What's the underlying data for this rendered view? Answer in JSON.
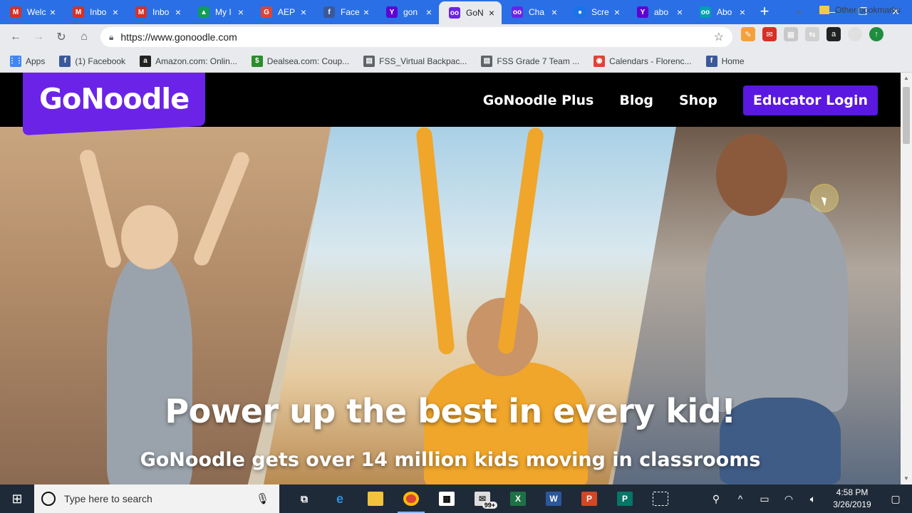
{
  "browser": {
    "tabs": [
      {
        "title": "Welc",
        "favicon": "gmail-icon",
        "color": "#d93025",
        "glyph": "M"
      },
      {
        "title": "Inbo",
        "favicon": "gmail-icon",
        "color": "#d93025",
        "glyph": "M"
      },
      {
        "title": "Inbo",
        "favicon": "gmail-icon",
        "color": "#d93025",
        "glyph": "M"
      },
      {
        "title": "My I",
        "favicon": "google-drive-icon",
        "color": "#0f9d58",
        "glyph": "▲"
      },
      {
        "title": "AEP",
        "favicon": "google-plus-icon",
        "color": "#db4437",
        "glyph": "G"
      },
      {
        "title": "Face",
        "favicon": "facebook-icon",
        "color": "#3b5998",
        "glyph": "f"
      },
      {
        "title": "gon",
        "favicon": "yahoo-icon",
        "color": "#5f01d1",
        "glyph": "Y"
      },
      {
        "title": "GoN",
        "favicon": "gonoodle-icon",
        "color": "#6b23e8",
        "glyph": "oo",
        "active": true
      },
      {
        "title": "Cha",
        "favicon": "gonoodle-icon",
        "color": "#6b23e8",
        "glyph": "oo"
      },
      {
        "title": "Scre",
        "favicon": "screencast-icon",
        "color": "#1a73e8",
        "glyph": "●"
      },
      {
        "title": "abo",
        "favicon": "yahoo-icon",
        "color": "#5f01d1",
        "glyph": "Y"
      },
      {
        "title": "Abo",
        "favicon": "gonoodle-eyes-icon",
        "color": "#00a0b0",
        "glyph": "oo"
      }
    ],
    "new_tab": "+",
    "url": "https://www.gonoodle.com",
    "bookmarks": [
      {
        "label": "Apps",
        "icon": "apps-grid-icon",
        "color": "#4285f4",
        "glyph": "⋮⋮"
      },
      {
        "label": "(1) Facebook",
        "icon": "facebook-icon",
        "color": "#3b5998",
        "glyph": "f"
      },
      {
        "label": "Amazon.com: Onlin...",
        "icon": "amazon-icon",
        "color": "#222222",
        "glyph": "a"
      },
      {
        "label": "Dealsea.com: Coup...",
        "icon": "dealsea-icon",
        "color": "#2e8b2e",
        "glyph": "$"
      },
      {
        "label": "FSS_Virtual Backpac...",
        "icon": "page-icon",
        "color": "#5f6368",
        "glyph": "▤"
      },
      {
        "label": "FSS Grade 7 Team ...",
        "icon": "page-icon",
        "color": "#5f6368",
        "glyph": "▤"
      },
      {
        "label": "Calendars - Florenc...",
        "icon": "chrome-icon",
        "color": "#db4437",
        "glyph": "◉"
      },
      {
        "label": "Home",
        "icon": "facebook-icon",
        "color": "#3b5998",
        "glyph": "f"
      }
    ],
    "bookmarks_more": "»",
    "other_bookmarks": "Other bookmarks"
  },
  "site": {
    "logo": "GoNoodle",
    "nav": [
      "GoNoodle Plus",
      "Blog",
      "Shop"
    ],
    "login": "Educator Login",
    "hero_title": "Power up the best in every kid!",
    "hero_sub": "GoNoodle gets over 14 million kids moving in classrooms"
  },
  "taskbar": {
    "search_placeholder": "Type here to search",
    "mail_badge": "99+",
    "time": "4:58 PM",
    "date": "3/26/2019"
  }
}
